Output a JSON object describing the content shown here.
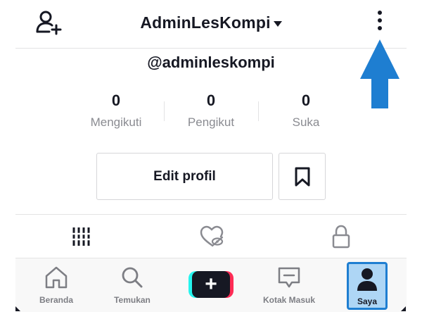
{
  "header": {
    "title": "AdminLesKompi",
    "icons": {
      "left": "add-user-icon",
      "right": "more-vertical-icon"
    }
  },
  "profile": {
    "username": "@adminleskompi",
    "stats": [
      {
        "value": "0",
        "label": "Mengikuti"
      },
      {
        "value": "0",
        "label": "Pengikut"
      },
      {
        "value": "0",
        "label": "Suka"
      }
    ],
    "edit_label": "Edit profil",
    "bookmark_icon": "bookmark-icon"
  },
  "tabs": [
    {
      "icon": "grid-icon",
      "active": true
    },
    {
      "icon": "liked-hidden-icon",
      "active": false
    },
    {
      "icon": "lock-icon",
      "active": false
    }
  ],
  "bottom_nav": {
    "items": [
      {
        "icon": "home-icon",
        "label": "Beranda"
      },
      {
        "icon": "search-icon",
        "label": "Temukan"
      },
      {
        "icon": "plus-icon",
        "label": ""
      },
      {
        "icon": "inbox-icon",
        "label": "Kotak Masuk"
      },
      {
        "icon": "profile-icon",
        "label": "Saya"
      }
    ]
  },
  "colors": {
    "text": "#161823",
    "muted": "#8a8b91",
    "divider": "#e3e3e4",
    "accent_cyan": "#25f4ee",
    "accent_red": "#fe2c55",
    "annotation_arrow": "#1e7ed1",
    "active_highlight": "#aed6f5"
  }
}
